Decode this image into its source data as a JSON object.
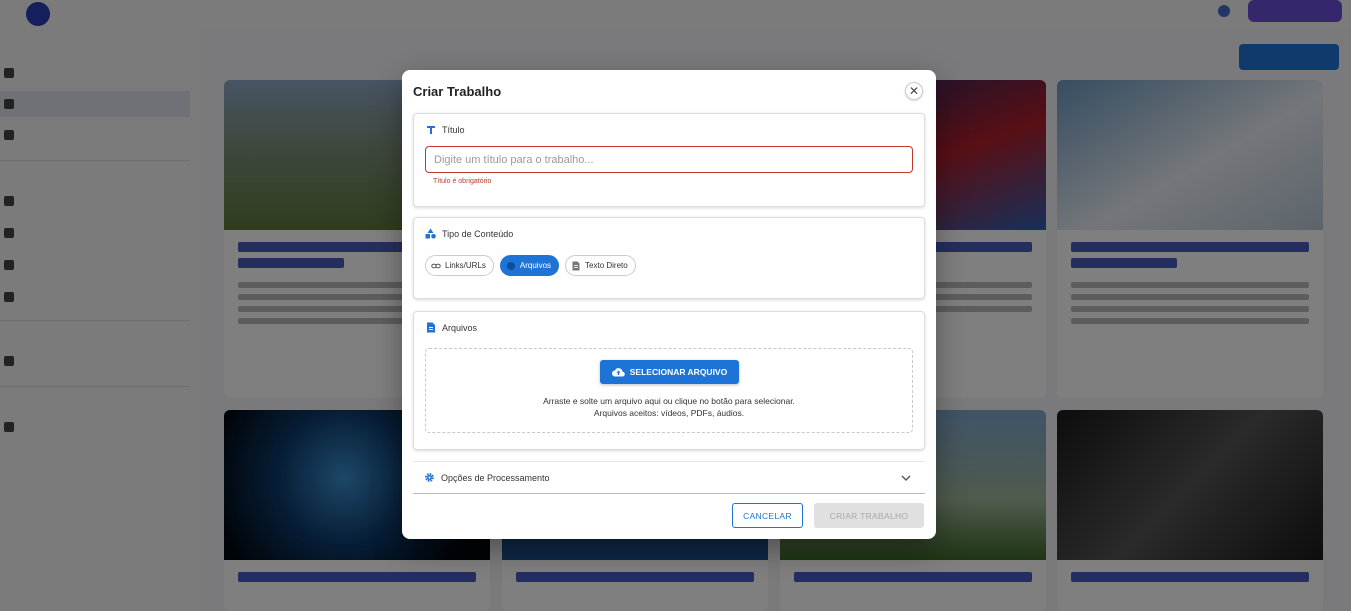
{
  "modal": {
    "title": "Criar Trabalho",
    "close_label": "✕",
    "title_section": {
      "label": "Título",
      "input_placeholder": "Digite um título para o trabalho...",
      "input_value": "",
      "error": "Título é obrigatório"
    },
    "content_type_section": {
      "label": "Tipo de Conteúdo",
      "options": [
        "Links/URLs",
        "Arquivos",
        "Texto Direto"
      ],
      "selected": "Arquivos"
    },
    "files_section": {
      "label": "Arquivos",
      "select_button": "SELECIONAR ARQUIVO",
      "hint_line1": "Arraste e solte um arquivo aqui ou clique no botão para selecionar.",
      "hint_line2": "Arquivos aceitos: vídeos, PDFs, áudios."
    },
    "processing_options": {
      "label": "Opções de Processamento",
      "expanded": false
    },
    "actions": {
      "cancel": "CANCELAR",
      "create": "CRIAR TRABALHO",
      "create_disabled": true
    }
  },
  "colors": {
    "primary": "#1e74d6",
    "error": "#c0392b",
    "disabled_bg": "#e0e0e0",
    "brand": "#2b3fb6"
  },
  "icons": {
    "title": "text-format-icon",
    "content_type": "category-icon",
    "files": "file-icon",
    "link": "link-icon",
    "upload": "cloud-upload-icon",
    "text": "document-icon",
    "settings": "gear-icon",
    "expand": "chevron-down-icon",
    "close": "close-icon"
  }
}
